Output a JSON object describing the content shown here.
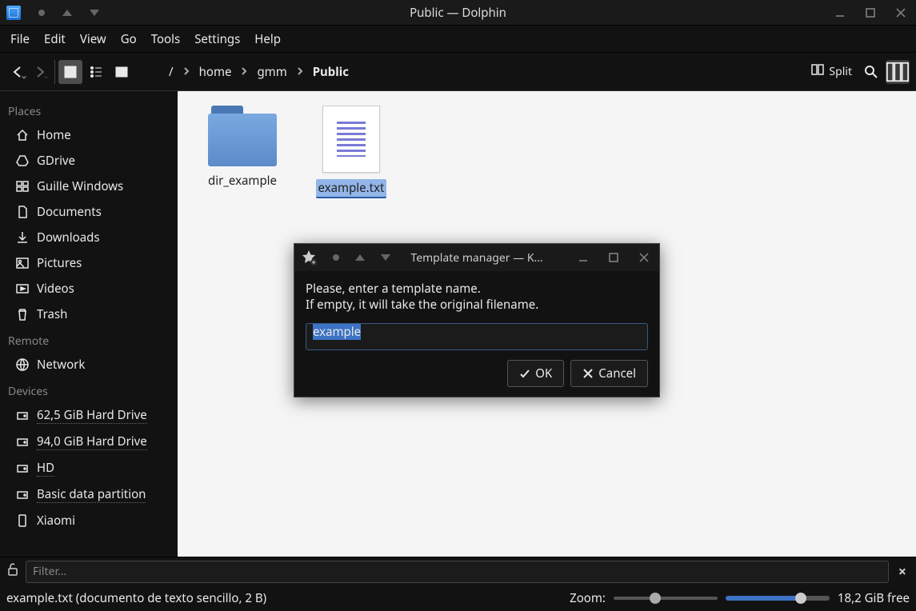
{
  "window": {
    "title": "Public — Dolphin"
  },
  "menu": {
    "file": "File",
    "edit": "Edit",
    "view": "View",
    "go": "Go",
    "tools": "Tools",
    "settings": "Settings",
    "help": "Help"
  },
  "toolbar": {
    "split": "Split"
  },
  "breadcrumb": {
    "root": "/",
    "seg1": "home",
    "seg2": "gmm",
    "seg3": "Public"
  },
  "sidebar": {
    "places_header": "Places",
    "places": [
      {
        "label": "Home"
      },
      {
        "label": "GDrive"
      },
      {
        "label": "Guille Windows"
      },
      {
        "label": "Documents"
      },
      {
        "label": "Downloads"
      },
      {
        "label": "Pictures"
      },
      {
        "label": "Videos"
      },
      {
        "label": "Trash"
      }
    ],
    "remote_header": "Remote",
    "remote": [
      {
        "label": "Network"
      }
    ],
    "devices_header": "Devices",
    "devices": [
      {
        "label": "62,5 GiB Hard Drive"
      },
      {
        "label": "94,0 GiB Hard Drive"
      },
      {
        "label": "HD"
      },
      {
        "label": "Basic data partition"
      },
      {
        "label": "Xiaomi"
      }
    ]
  },
  "files": {
    "items": [
      {
        "name": "dir_example",
        "type": "folder",
        "selected": false
      },
      {
        "name": "example.txt",
        "type": "text",
        "selected": true
      }
    ]
  },
  "dialog": {
    "title": "Template manager — K…",
    "text1": "Please, enter a template name.",
    "text2": "If empty, it will take the original filename.",
    "value": "example",
    "ok": "OK",
    "cancel": "Cancel"
  },
  "filter": {
    "placeholder": "Filter..."
  },
  "status": {
    "selection": "example.txt (documento de texto sencillo, 2 B)",
    "zoom_label": "Zoom:",
    "free": "18,2 GiB free"
  }
}
